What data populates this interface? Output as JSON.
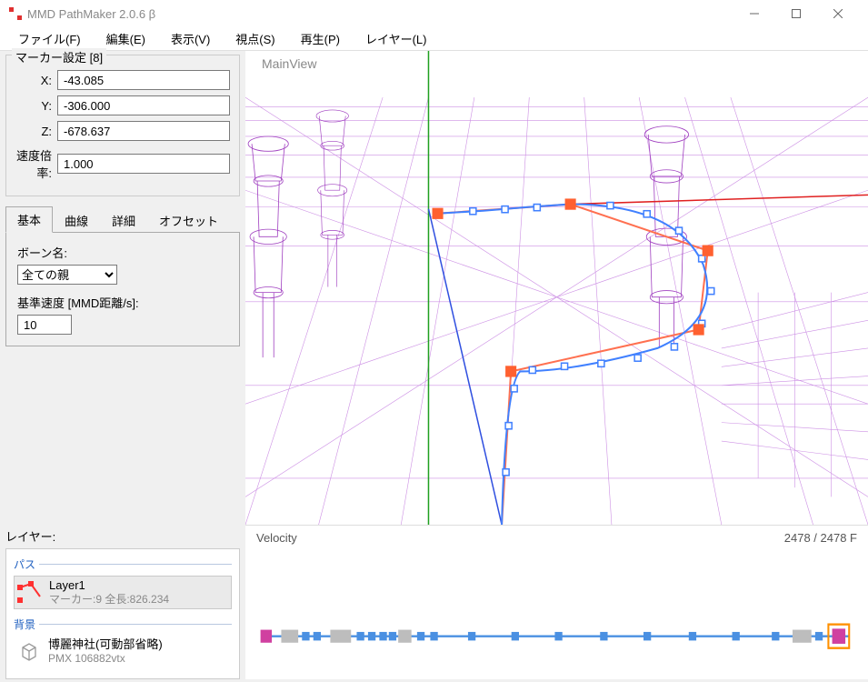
{
  "window": {
    "title": "MMD PathMaker 2.0.6 β"
  },
  "menu": {
    "file": "ファイル(F)",
    "edit": "編集(E)",
    "view": "表示(V)",
    "viewpoint": "視点(S)",
    "play": "再生(P)",
    "layer": "レイヤー(L)"
  },
  "marker": {
    "title": "マーカー設定 [8]",
    "xlabel": "X:",
    "ylabel": "Y:",
    "zlabel": "Z:",
    "speedlabel": "速度倍率:",
    "x": "-43.085",
    "y": "-306.000",
    "z": "-678.637",
    "speed": "1.000"
  },
  "tabs": {
    "basic": "基本",
    "curve": "曲線",
    "detail": "詳細",
    "offset": "オフセット"
  },
  "basic": {
    "bone_label": "ボーン名:",
    "bone_value": "全ての親",
    "speed_label": "基準速度 [MMD距離/s]:",
    "speed_value": "10"
  },
  "layers": {
    "section_label": "レイヤー:",
    "path_label": "パス",
    "bg_label": "背景",
    "layer1": {
      "name": "Layer1",
      "sub": "マーカー:9 全長:826.234"
    },
    "bg1": {
      "name": "博麗神社(可動部省略)",
      "sub": "PMX 106882vtx"
    }
  },
  "mainview": {
    "label": "MainView"
  },
  "velocity": {
    "label": "Velocity",
    "frames": "2478 / 2478 F"
  }
}
